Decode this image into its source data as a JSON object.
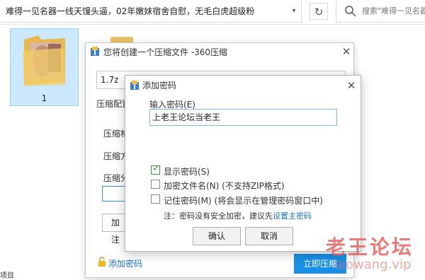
{
  "explorer": {
    "address_path": "难得一见名器一线天馒头逼，02年嫩妹宿舍自慰，无毛白虎超级粉",
    "search_placeholder": "搜索\"难得一见名器一线天馒头逼",
    "folder_name": "1",
    "sidebar_text": "项目"
  },
  "archive_dialog": {
    "title": "您将创建一个压缩文件 -360压缩",
    "filename": "1.7z",
    "compress_config_label": "压缩配置",
    "format_label": "压缩格",
    "method_label": "压缩方",
    "split_label": "压缩分",
    "add_button": "加注",
    "add_password_link": "添加密码",
    "start_button": "立即压缩"
  },
  "password_dialog": {
    "title": "添加密码",
    "input_label": "输入密码(E)",
    "password_value": "上老王论坛当老王",
    "options": [
      {
        "label": "显示密码(S)",
        "checked": true
      },
      {
        "label": "加密文件名(N) (不支持ZIP格式)",
        "checked": false
      },
      {
        "label": "记住密码(M) (将会显示在管理密码窗口中)",
        "checked": false
      }
    ],
    "note_prefix": "注：密码没有安全加密，建议先",
    "note_link": "设置主密码",
    "ok_button": "确认",
    "cancel_button": "取消"
  },
  "watermark": {
    "line1": "老王论坛",
    "line2": "laowang.vip"
  }
}
